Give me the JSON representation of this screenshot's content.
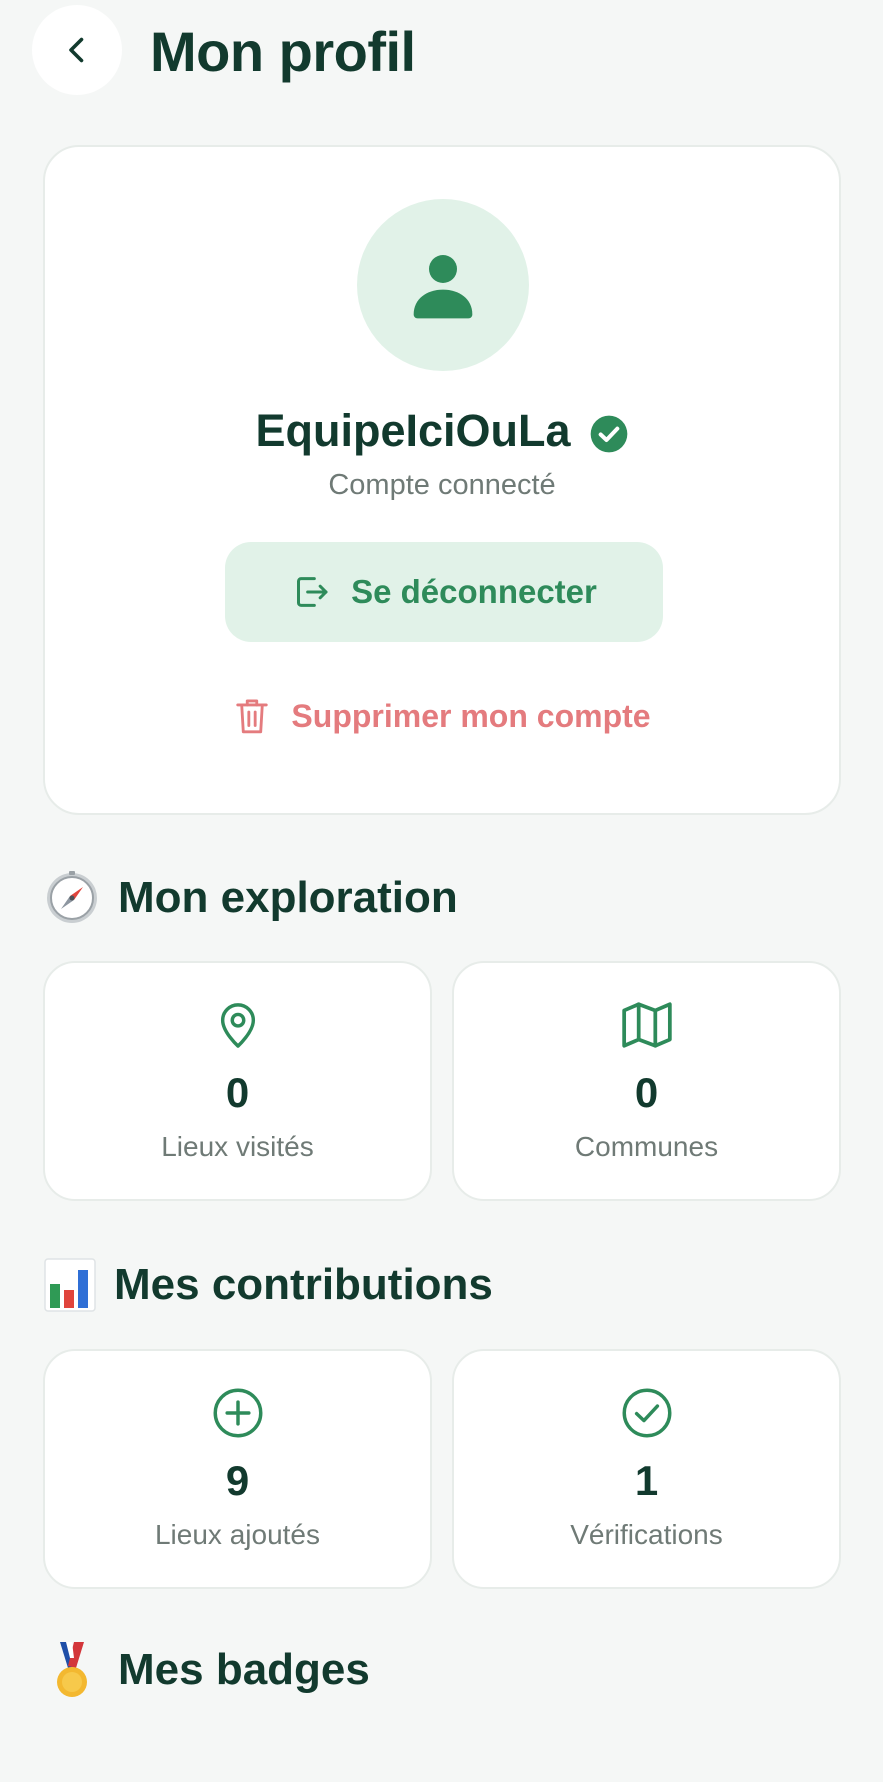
{
  "header": {
    "title": "Mon profil",
    "back_icon": "chevron-left-icon"
  },
  "profile": {
    "username": "EquipeIciOuLa",
    "status": "Compte connecté",
    "verified": true,
    "logout_label": "Se déconnecter",
    "delete_label": "Supprimer mon compte",
    "avatar_icon": "user-icon"
  },
  "exploration": {
    "title": "Mon exploration",
    "icon": "compass-icon",
    "stats": [
      {
        "value": "0",
        "label": "Lieux visités",
        "icon": "map-pin-icon"
      },
      {
        "value": "0",
        "label": "Communes",
        "icon": "map-icon"
      }
    ]
  },
  "contributions": {
    "title": "Mes contributions",
    "icon": "bar-chart-icon",
    "stats": [
      {
        "value": "9",
        "label": "Lieux ajoutés",
        "icon": "plus-circle-icon"
      },
      {
        "value": "1",
        "label": "Vérifications",
        "icon": "check-circle-icon"
      }
    ]
  },
  "badges": {
    "title": "Mes badges",
    "icon": "medal-icon"
  },
  "colors": {
    "primary": "#2e8b5a",
    "primary_light": "#e1f2e8",
    "danger": "#e47b7e",
    "text_dark": "#123a2e",
    "text_muted": "#6f7a76",
    "background": "#f5f7f6"
  }
}
